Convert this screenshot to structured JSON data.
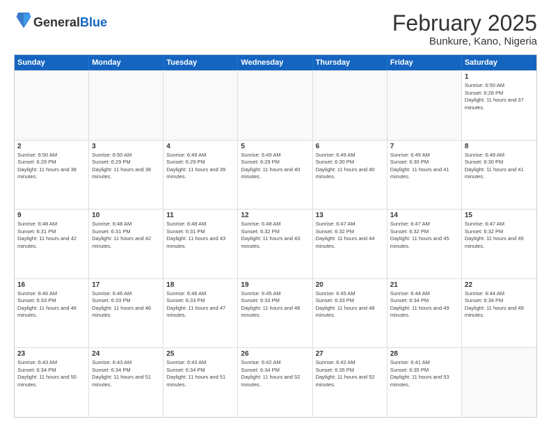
{
  "logo": {
    "general": "General",
    "blue": "Blue"
  },
  "title": "February 2025",
  "subtitle": "Bunkure, Kano, Nigeria",
  "headers": [
    "Sunday",
    "Monday",
    "Tuesday",
    "Wednesday",
    "Thursday",
    "Friday",
    "Saturday"
  ],
  "weeks": [
    [
      {
        "day": "",
        "info": ""
      },
      {
        "day": "",
        "info": ""
      },
      {
        "day": "",
        "info": ""
      },
      {
        "day": "",
        "info": ""
      },
      {
        "day": "",
        "info": ""
      },
      {
        "day": "",
        "info": ""
      },
      {
        "day": "1",
        "info": "Sunrise: 6:50 AM\nSunset: 6:28 PM\nDaylight: 11 hours and 37 minutes."
      }
    ],
    [
      {
        "day": "2",
        "info": "Sunrise: 6:50 AM\nSunset: 6:28 PM\nDaylight: 11 hours and 38 minutes."
      },
      {
        "day": "3",
        "info": "Sunrise: 6:50 AM\nSunset: 6:29 PM\nDaylight: 11 hours and 38 minutes."
      },
      {
        "day": "4",
        "info": "Sunrise: 6:49 AM\nSunset: 6:29 PM\nDaylight: 11 hours and 39 minutes."
      },
      {
        "day": "5",
        "info": "Sunrise: 6:49 AM\nSunset: 6:29 PM\nDaylight: 11 hours and 40 minutes."
      },
      {
        "day": "6",
        "info": "Sunrise: 6:49 AM\nSunset: 6:30 PM\nDaylight: 11 hours and 40 minutes."
      },
      {
        "day": "7",
        "info": "Sunrise: 6:49 AM\nSunset: 6:30 PM\nDaylight: 11 hours and 41 minutes."
      },
      {
        "day": "8",
        "info": "Sunrise: 6:49 AM\nSunset: 6:30 PM\nDaylight: 11 hours and 41 minutes."
      }
    ],
    [
      {
        "day": "9",
        "info": "Sunrise: 6:48 AM\nSunset: 6:31 PM\nDaylight: 11 hours and 42 minutes."
      },
      {
        "day": "10",
        "info": "Sunrise: 6:48 AM\nSunset: 6:31 PM\nDaylight: 11 hours and 42 minutes."
      },
      {
        "day": "11",
        "info": "Sunrise: 6:48 AM\nSunset: 6:31 PM\nDaylight: 11 hours and 43 minutes."
      },
      {
        "day": "12",
        "info": "Sunrise: 6:48 AM\nSunset: 6:32 PM\nDaylight: 11 hours and 43 minutes."
      },
      {
        "day": "13",
        "info": "Sunrise: 6:47 AM\nSunset: 6:32 PM\nDaylight: 11 hours and 44 minutes."
      },
      {
        "day": "14",
        "info": "Sunrise: 6:47 AM\nSunset: 6:32 PM\nDaylight: 11 hours and 45 minutes."
      },
      {
        "day": "15",
        "info": "Sunrise: 6:47 AM\nSunset: 6:32 PM\nDaylight: 11 hours and 45 minutes."
      }
    ],
    [
      {
        "day": "16",
        "info": "Sunrise: 6:46 AM\nSunset: 6:33 PM\nDaylight: 11 hours and 46 minutes."
      },
      {
        "day": "17",
        "info": "Sunrise: 6:46 AM\nSunset: 6:33 PM\nDaylight: 11 hours and 46 minutes."
      },
      {
        "day": "18",
        "info": "Sunrise: 6:46 AM\nSunset: 6:33 PM\nDaylight: 11 hours and 47 minutes."
      },
      {
        "day": "19",
        "info": "Sunrise: 6:45 AM\nSunset: 6:33 PM\nDaylight: 11 hours and 48 minutes."
      },
      {
        "day": "20",
        "info": "Sunrise: 6:45 AM\nSunset: 6:33 PM\nDaylight: 11 hours and 48 minutes."
      },
      {
        "day": "21",
        "info": "Sunrise: 6:44 AM\nSunset: 6:34 PM\nDaylight: 11 hours and 49 minutes."
      },
      {
        "day": "22",
        "info": "Sunrise: 6:44 AM\nSunset: 6:34 PM\nDaylight: 11 hours and 49 minutes."
      }
    ],
    [
      {
        "day": "23",
        "info": "Sunrise: 6:43 AM\nSunset: 6:34 PM\nDaylight: 11 hours and 50 minutes."
      },
      {
        "day": "24",
        "info": "Sunrise: 6:43 AM\nSunset: 6:34 PM\nDaylight: 11 hours and 51 minutes."
      },
      {
        "day": "25",
        "info": "Sunrise: 6:43 AM\nSunset: 6:34 PM\nDaylight: 11 hours and 51 minutes."
      },
      {
        "day": "26",
        "info": "Sunrise: 6:42 AM\nSunset: 6:34 PM\nDaylight: 11 hours and 52 minutes."
      },
      {
        "day": "27",
        "info": "Sunrise: 6:42 AM\nSunset: 6:35 PM\nDaylight: 11 hours and 52 minutes."
      },
      {
        "day": "28",
        "info": "Sunrise: 6:41 AM\nSunset: 6:35 PM\nDaylight: 11 hours and 53 minutes."
      },
      {
        "day": "",
        "info": ""
      }
    ]
  ]
}
